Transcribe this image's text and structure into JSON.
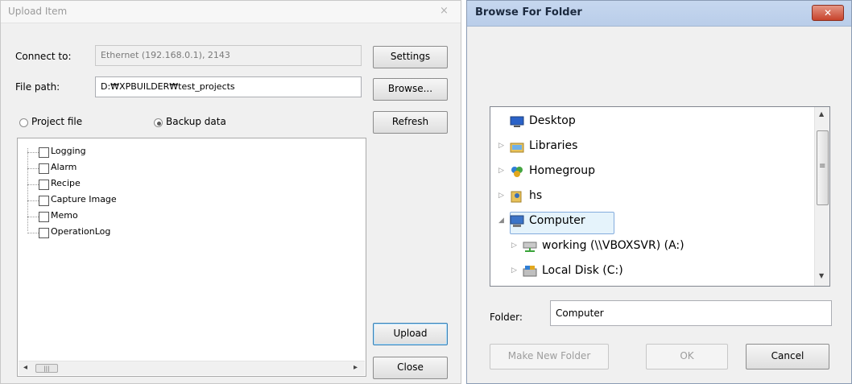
{
  "upload_dialog": {
    "title": "Upload Item",
    "close_glyph": "×",
    "connect_label": "Connect to:",
    "connect_value": "Ethernet (192.168.0.1), 2143",
    "filepath_label": "File path:",
    "filepath_value": "D:₩XPBUILDER₩test_projects",
    "settings_button": "Settings",
    "browse_button": "Browse...",
    "refresh_button": "Refresh",
    "radio_project": "Project file",
    "radio_backup": "Backup data",
    "selected_radio": "Backup data",
    "tree_items": [
      "Logging",
      "Alarm",
      "Recipe",
      "Capture Image",
      "Memo",
      "OperationLog"
    ],
    "upload_button": "Upload",
    "close_button": "Close",
    "scroll_left_glyph": "◂",
    "scroll_right_glyph": "▸",
    "scroll_thumb_glyph": "|||"
  },
  "browse_dialog": {
    "title": "Browse For Folder",
    "close_glyph": "✕",
    "folders": [
      {
        "name": "Desktop",
        "icon": "desktop-icon",
        "expander": "",
        "selected": false
      },
      {
        "name": "Libraries",
        "icon": "libraries-icon",
        "expander": "▷",
        "selected": false
      },
      {
        "name": "Homegroup",
        "icon": "homegroup-icon",
        "expander": "▷",
        "selected": false
      },
      {
        "name": "hs",
        "icon": "user-folder-icon",
        "expander": "▷",
        "selected": false
      },
      {
        "name": "Computer",
        "icon": "computer-icon",
        "expander": "◢",
        "selected": true
      },
      {
        "name": "working (\\\\VBOXSVR) (A:)",
        "icon": "network-drive-icon",
        "expander": "▷",
        "selected": false
      },
      {
        "name": "Local Disk (C:)",
        "icon": "local-disk-icon",
        "expander": "▷",
        "selected": false
      }
    ],
    "scroll_up_glyph": "▲",
    "scroll_down_glyph": "▼",
    "scroll_grip_glyph": "≡",
    "folder_label": "Folder:",
    "folder_value": "Computer",
    "make_new_folder_button": "Make New Folder",
    "ok_button": "OK",
    "cancel_button": "Cancel",
    "colors": {
      "titlebar": "#c6d7ef",
      "close": "#c7432b",
      "selection": "#e5f3fb"
    }
  }
}
